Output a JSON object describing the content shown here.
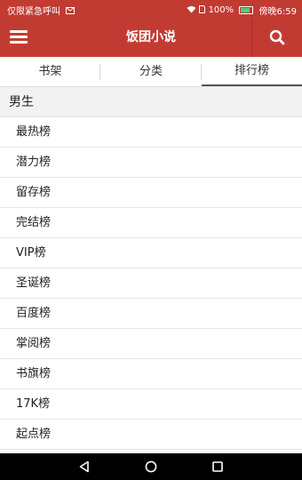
{
  "status_bar": {
    "left_text": "仅限紧急呼叫",
    "battery": "100%",
    "time": "傍晚6:59"
  },
  "app_bar": {
    "title": "饭团小说",
    "menu_icon": "hamburger-menu-icon",
    "search_icon": "search-icon"
  },
  "tabs": [
    {
      "label": "书架"
    },
    {
      "label": "分类"
    },
    {
      "label": "排行榜",
      "active": true
    }
  ],
  "section": {
    "title": "男生"
  },
  "rankings": [
    {
      "label": "最热榜"
    },
    {
      "label": "潜力榜"
    },
    {
      "label": "留存榜"
    },
    {
      "label": "完结榜"
    },
    {
      "label": "VIP榜"
    },
    {
      "label": "圣诞榜"
    },
    {
      "label": "百度榜"
    },
    {
      "label": "掌阅榜"
    },
    {
      "label": "书旗榜"
    },
    {
      "label": "17K榜"
    },
    {
      "label": "起点榜"
    }
  ],
  "colors": {
    "accent": "#c23b33",
    "section_bg": "#f2f2f2",
    "nav_bar": "#000000"
  },
  "nav_bar": {
    "back_icon": "back-triangle-icon",
    "home_icon": "home-circle-icon",
    "recents_icon": "recents-square-icon"
  }
}
